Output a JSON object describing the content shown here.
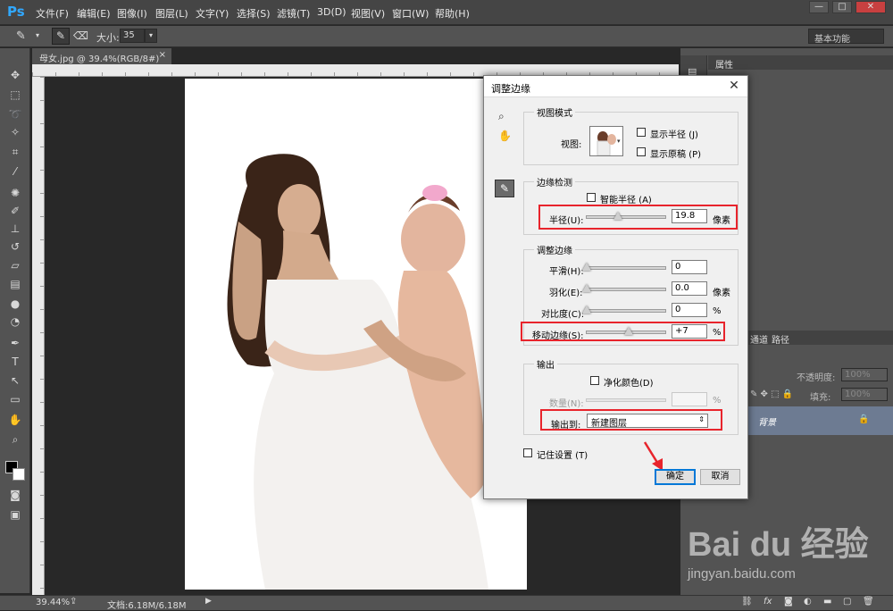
{
  "app": {
    "logo": "Ps"
  },
  "menu": [
    "文件(F)",
    "编辑(E)",
    "图像(I)",
    "图层(L)",
    "文字(Y)",
    "选择(S)",
    "滤镜(T)",
    "3D(D)",
    "视图(V)",
    "窗口(W)",
    "帮助(H)"
  ],
  "options": {
    "size_label": "大小:",
    "size_value": "35",
    "workspace": "基本功能"
  },
  "document_tab": {
    "title": "母女.jpg @ 39.4%(RGB/8#)",
    "close": "×"
  },
  "panels": {
    "properties_title": "属性",
    "channels_tab": "通道",
    "paths_tab": "路径",
    "opacity_label": "不透明度:",
    "opacity_value": "100%",
    "fill_label": "填充:",
    "fill_value": "100%",
    "layer_name": "背景"
  },
  "status": {
    "zoom": "39.44%",
    "doc": "文档:6.18M/6.18M"
  },
  "dialog": {
    "title": "调整边缘",
    "view_mode": {
      "group": "视图模式",
      "view_label": "视图:",
      "show_radius": "显示半径 (J)",
      "show_original": "显示原稿 (P)"
    },
    "edge_detection": {
      "group": "边缘检测",
      "smart_radius": "智能半径 (A)",
      "radius_label": "半径(U):",
      "radius_value": "19.8",
      "radius_unit": "像素",
      "radius_level": 0.4
    },
    "adjust_edge": {
      "group": "调整边缘",
      "smooth_label": "平滑(H):",
      "smooth_value": "0",
      "feather_label": "羽化(E):",
      "feather_value": "0.0",
      "feather_unit": "像素",
      "contrast_label": "对比度(C):",
      "contrast_value": "0",
      "contrast_unit": "%",
      "shift_label": "移动边缘(S):",
      "shift_value": "+7",
      "shift_unit": "%",
      "shift_level": 0.535
    },
    "output": {
      "group": "输出",
      "decontaminate": "净化颜色(D)",
      "amount_label": "数量(N):",
      "amount_unit": "%",
      "output_to_label": "输出到:",
      "output_to_value": "新建图层"
    },
    "remember": "记住设置 (T)",
    "ok": "确定",
    "cancel": "取消"
  },
  "watermark": {
    "brand": "Bai du 经验",
    "url": "jingyan.baidu.com"
  },
  "colors": {
    "highlight": "#e8242c",
    "ps_blue": "#31a8ff",
    "layer_selected": "#6d7b92"
  }
}
